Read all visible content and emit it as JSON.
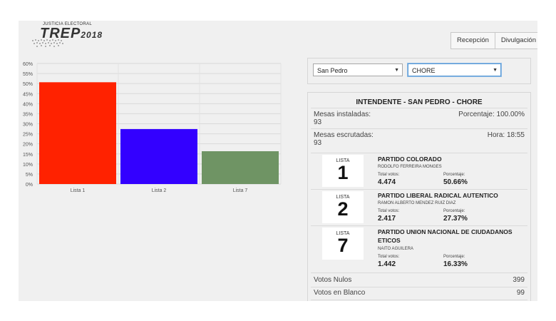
{
  "header": {
    "logo_small": "JUSTICIA ELECTORAL",
    "logo_big": "TREP",
    "logo_year": "2018",
    "tabs": [
      {
        "label": "Recepción"
      },
      {
        "label": "Divulgación"
      }
    ]
  },
  "chart_data": {
    "type": "bar",
    "categories": [
      "Lista 1",
      "Lista 2",
      "Lista 7"
    ],
    "values": [
      50.66,
      27.37,
      16.33
    ],
    "colors": [
      "#ff2200",
      "#3300ff",
      "#6f9464"
    ],
    "ylim": [
      0,
      60
    ],
    "yticks": [
      "0%",
      "5%",
      "10%",
      "15%",
      "20%",
      "25%",
      "30%",
      "35%",
      "40%",
      "45%",
      "50%",
      "55%",
      "60%"
    ],
    "grid": true
  },
  "filters": {
    "departamento": "San Pedro",
    "distrito": "CHORE"
  },
  "results": {
    "title": "INTENDENTE - SAN PEDRO - CHORE",
    "mesas_instaladas_label": "Mesas instaladas:",
    "mesas_instaladas": "93",
    "porcentaje": "Porcentaje: 100.00%",
    "mesas_escrutadas_label": "Mesas escrutadas:",
    "mesas_escrutadas": "93",
    "hora": "Hora: 18:55",
    "candidates": [
      {
        "lista_label": "LISTA",
        "lista": "1",
        "party": "PARTIDO COLORADO",
        "candidate": "RODOLFO FERREIRA MONGES",
        "votes_label": "Total votos:",
        "votes": "4.474",
        "pct_label": "Porcentaje:",
        "pct": "50.66%"
      },
      {
        "lista_label": "LISTA",
        "lista": "2",
        "party": "PARTIDO LIBERAL RADICAL AUTENTICO",
        "candidate": "RAMON ALBERTO MENDEZ RUIZ DIAZ",
        "votes_label": "Total votos:",
        "votes": "2.417",
        "pct_label": "Porcentaje:",
        "pct": "27.37%"
      },
      {
        "lista_label": "LISTA",
        "lista": "7",
        "party": "PARTIDO UNION NACIONAL DE CIUDADANOS ETICOS",
        "candidate": "NAITO AGUILERA",
        "votes_label": "Total votos:",
        "votes": "1.442",
        "pct_label": "Porcentaje:",
        "pct": "16.33%"
      }
    ],
    "nulos_label": "Votos Nulos",
    "nulos": "399",
    "blanco_label": "Votos en Blanco",
    "blanco": "99"
  }
}
